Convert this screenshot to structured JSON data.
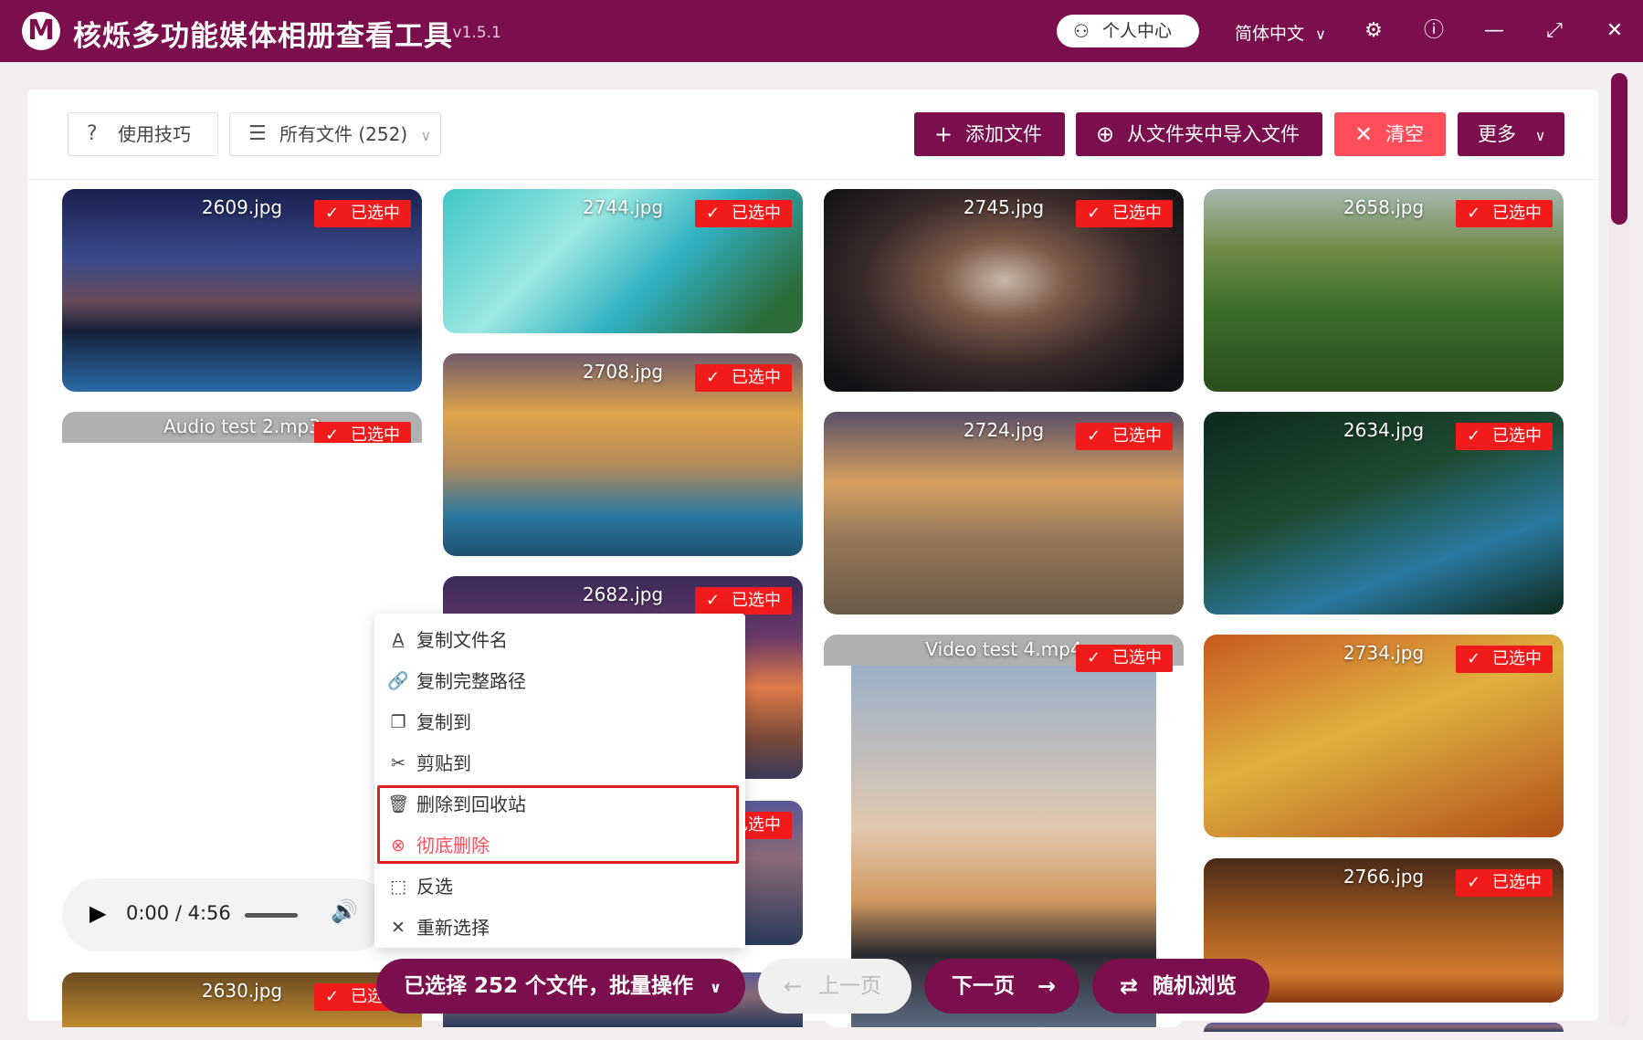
{
  "titlebar": {
    "logo": "M",
    "title": "核烁多功能媒体相册查看工具",
    "version": "- v1.5.1",
    "user_center": "个人中心",
    "language": "简体中文",
    "icons": [
      "user-icon",
      "chevron-down-icon",
      "gear-icon",
      "help-icon",
      "minimize-icon",
      "maximize-icon",
      "close-icon"
    ]
  },
  "toolbar": {
    "tips": "使用技巧",
    "all_files": "所有文件 (252)",
    "add_files": "添加文件",
    "import_folder": "从文件夹中导入文件",
    "clear": "清空",
    "more": "更多"
  },
  "selected_badge": "已选中",
  "files": {
    "f2609": "2609.jpg",
    "f2744": "2744.jpg",
    "f2745": "2745.jpg",
    "f2658": "2658.jpg",
    "audio2": "Audio test 2.mp3",
    "f2708": "2708.jpg",
    "f2724": "2724.jpg",
    "f2634": "2634.jpg",
    "f2682": "2682.jpg",
    "video4": "Video test 4.mp4",
    "f2734": "2734.jpg",
    "f2766": "2766.jpg",
    "f2630": "2630.jpg"
  },
  "audio_player": {
    "time": "0:00 / 4:56"
  },
  "context_menu": {
    "copy_name": "复制文件名",
    "copy_path": "复制完整路径",
    "copy_to": "复制到",
    "cut_to": "剪贴到",
    "recycle": "删除到回收站",
    "delete": "彻底删除",
    "invert": "反选",
    "reselect": "重新选择"
  },
  "bottom": {
    "batch": "已选择 252 个文件，批量操作",
    "prev": "上一页",
    "next": "下一页",
    "random": "随机浏览"
  },
  "colors": {
    "brand": "#7b0e4d",
    "selected": "#f21b1b",
    "danger": "#ff4d5a"
  }
}
